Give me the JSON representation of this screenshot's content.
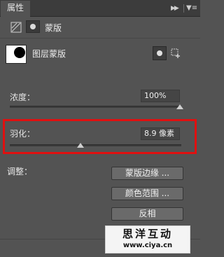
{
  "tab": {
    "title": "属性"
  },
  "mode": {
    "label": "蒙版"
  },
  "layer": {
    "label": "图层蒙版"
  },
  "density": {
    "label": "浓度：",
    "value": "100%",
    "percent": 100
  },
  "feather": {
    "label": "羽化：",
    "value": "8.9 像素",
    "fraction": 0.41
  },
  "adjust": {
    "label": "调整：",
    "buttons": [
      "蒙版边缘 ...",
      "颜色范围 ...",
      "反相"
    ]
  },
  "watermark": {
    "title": "思洋互动",
    "url": "www.ciya.cn"
  },
  "colors": {
    "panel": "#535353",
    "highlight": "#e01010"
  },
  "icons": [
    "panel-collapse-icon",
    "panel-menu-icon",
    "pixel-mask-icon",
    "vector-mask-icon",
    "select-mask-icon",
    "apply-mask-icon"
  ]
}
